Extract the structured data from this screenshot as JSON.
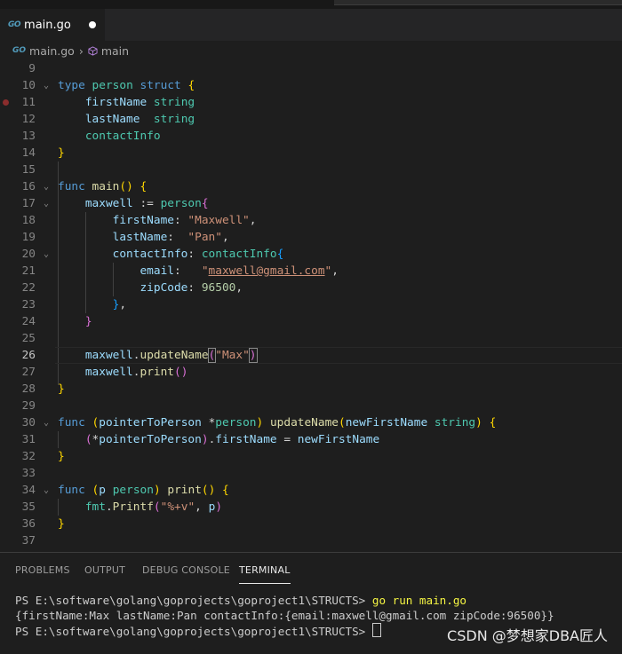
{
  "tab": {
    "icon_text": "GO",
    "filename": "main.go",
    "modified_icon": "dot-icon"
  },
  "breadcrumb": {
    "file": "main.go",
    "symbol": "main",
    "symbol_icon": "cube-icon"
  },
  "colors": {
    "keyword": "#569cd6",
    "type": "#4ec9b0",
    "function": "#dcdcaa",
    "variable": "#9cdcfe",
    "string": "#ce9178",
    "number": "#b5cea8"
  },
  "editor": {
    "lines": [
      {
        "n": "9"
      },
      {
        "n": "10"
      },
      {
        "n": "11"
      },
      {
        "n": "12"
      },
      {
        "n": "13"
      },
      {
        "n": "14"
      },
      {
        "n": "15"
      },
      {
        "n": "16"
      },
      {
        "n": "17"
      },
      {
        "n": "18"
      },
      {
        "n": "19"
      },
      {
        "n": "20"
      },
      {
        "n": "21"
      },
      {
        "n": "22"
      },
      {
        "n": "23"
      },
      {
        "n": "24"
      },
      {
        "n": "25"
      },
      {
        "n": "26"
      },
      {
        "n": "27"
      },
      {
        "n": "28"
      },
      {
        "n": "29"
      },
      {
        "n": "30"
      },
      {
        "n": "31"
      },
      {
        "n": "32"
      },
      {
        "n": "33"
      },
      {
        "n": "34"
      },
      {
        "n": "35"
      },
      {
        "n": "36"
      },
      {
        "n": "37"
      }
    ],
    "tok": {
      "type_kw": "type",
      "person": "person",
      "struct_kw": "struct",
      "lbrace": "{",
      "rbrace": "}",
      "firstName": "firstName",
      "string_t": "string",
      "lastName": "lastName",
      "contactInfo": "contactInfo",
      "func_kw": "func",
      "main": "main",
      "parens": "()",
      "maxwell": "maxwell",
      "assign": " := ",
      "firstName_key": "firstName",
      "colon": ":",
      "maxwell_str": "\"Maxwell\"",
      "comma": ",",
      "lastName_key": "lastName",
      "pan_str": "\"Pan\"",
      "contactInfo_key": "contactInfo",
      "email_key": "email",
      "email_str_q1": "\"",
      "email_str_body": "maxwell@gmail.com",
      "email_str_q2": "\"",
      "zip_key": "zipCode",
      "zip_val": "96500",
      "dot": ".",
      "updateName": "updateName",
      "lparen": "(",
      "rparen": ")",
      "max_str": "\"Max\"",
      "print": "print",
      "pointerToPerson": "pointerToPerson",
      "star": "*",
      "newFirstName": "newFirstName",
      "eq": " = ",
      "p": "p",
      "fmt": "fmt",
      "printf": "Printf",
      "fmt_str": "\"%+v\""
    }
  },
  "panel": {
    "tabs": [
      "PROBLEMS",
      "OUTPUT",
      "DEBUG CONSOLE",
      "TERMINAL"
    ],
    "active_tab": "TERMINAL",
    "terminal": {
      "prompt1": "PS E:\\software\\golang\\goprojects\\goproject1\\STRUCTS> ",
      "command1": "go run main.go",
      "output1": "{firstName:Max lastName:Pan contactInfo:{email:maxwell@gmail.com zipCode:96500}}",
      "prompt2": "PS E:\\software\\golang\\goprojects\\goproject1\\STRUCTS> "
    }
  },
  "watermark": "CSDN @梦想家DBA匠人"
}
